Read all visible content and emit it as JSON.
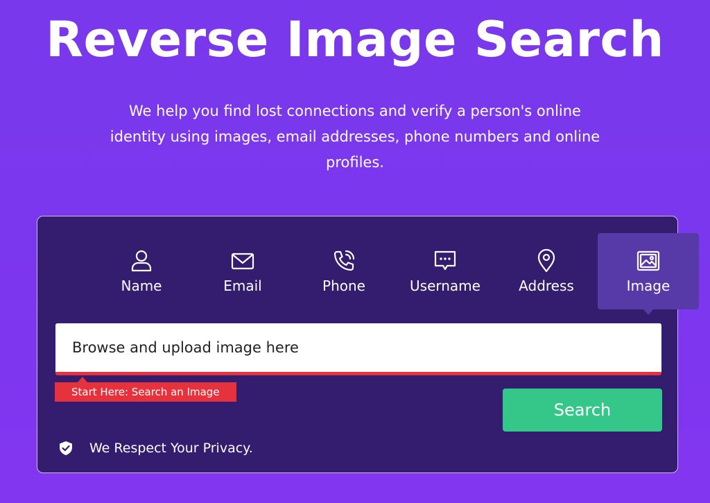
{
  "hero": {
    "title": "Reverse Image Search",
    "subtitle": "We help you find lost connections and verify a person's online identity using images, email addresses, phone numbers and online profiles."
  },
  "tabs": [
    {
      "label": "Name",
      "icon": "user-icon",
      "active": false
    },
    {
      "label": "Email",
      "icon": "envelope-icon",
      "active": false
    },
    {
      "label": "Phone",
      "icon": "phone-icon",
      "active": false
    },
    {
      "label": "Username",
      "icon": "chat-bubble-icon",
      "active": false
    },
    {
      "label": "Address",
      "icon": "location-pin-icon",
      "active": true
    },
    {
      "label": "Image",
      "icon": "image-icon",
      "active": true
    }
  ],
  "upload": {
    "placeholder": "Browse and upload image here"
  },
  "hint": {
    "label": "Start Here: Search an Image"
  },
  "search": {
    "label": "Search"
  },
  "privacy": {
    "text": "We Respect Your Privacy.",
    "icon": "shield-check-icon"
  },
  "colors": {
    "background": "#7b37ee",
    "card": "#341c6f",
    "active_tab": "#573aa8",
    "accent_red": "#e5323d",
    "search_green": "#35c789"
  }
}
